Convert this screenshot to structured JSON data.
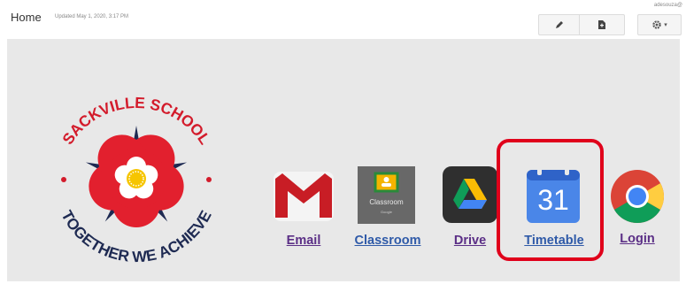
{
  "header": {
    "title": "Home",
    "updated": "Updated May 1, 2020, 3:17 PM",
    "user": "adesouza@",
    "edit_icon": "pencil-icon",
    "page_icon": "new-page-icon",
    "settings_icon": "gear-icon",
    "caret": "▾"
  },
  "logo": {
    "top_text": "SACKVILLE SCHOOL",
    "bottom_text": "TOGETHER WE ACHIEVE",
    "emblem": "tudor-rose-icon"
  },
  "apps": [
    {
      "label": "Email",
      "icon": "gmail-icon"
    },
    {
      "label": "Classroom",
      "icon": "google-classroom-icon",
      "tile_text": "Classroom",
      "tile_subtext": "Google"
    },
    {
      "label": "Drive",
      "icon": "google-drive-icon"
    },
    {
      "label": "Timetable",
      "icon": "google-calendar-icon",
      "day": "31"
    },
    {
      "label": "Login",
      "icon": "chrome-icon"
    }
  ],
  "colors": {
    "highlight": "#e0001b",
    "link_purple": "#5b2f86",
    "link_blue": "#2f5aa8",
    "panel_bg": "#e8e8e8"
  }
}
